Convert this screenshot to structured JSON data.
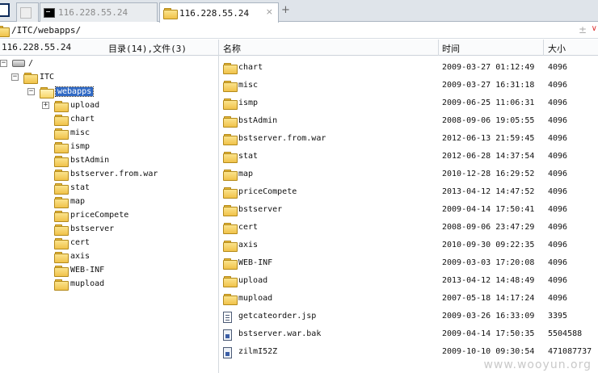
{
  "tabs": [
    {
      "label": "",
      "icon": "grey-square-icon"
    },
    {
      "label": "116.228.55.24",
      "icon": "terminal-icon"
    },
    {
      "label": "116.228.55.24",
      "icon": "folder-icon"
    }
  ],
  "tab_close": "×",
  "new_tab": "+",
  "address": {
    "path": "/ITC/webapps/",
    "add": "±",
    "menu": "∨"
  },
  "left_header": {
    "host": "116.228.55.24",
    "summary": "目录(14),文件(3)"
  },
  "tree": {
    "root": "/",
    "itc": "ITC",
    "webapps": "webapps",
    "children": [
      "upload",
      "chart",
      "misc",
      "ismp",
      "bstAdmin",
      "bstserver.from.war",
      "stat",
      "map",
      "priceCompete",
      "bstserver",
      "cert",
      "axis",
      "WEB-INF",
      "mupload"
    ]
  },
  "columns": {
    "name": "名称",
    "time": "时间",
    "size": "大小"
  },
  "files": [
    {
      "name": "chart",
      "time": "2009-03-27 01:12:49",
      "size": "4096",
      "type": "folder"
    },
    {
      "name": "misc",
      "time": "2009-03-27 16:31:18",
      "size": "4096",
      "type": "folder"
    },
    {
      "name": "ismp",
      "time": "2009-06-25 11:06:31",
      "size": "4096",
      "type": "folder"
    },
    {
      "name": "bstAdmin",
      "time": "2008-09-06 19:05:55",
      "size": "4096",
      "type": "folder"
    },
    {
      "name": "bstserver.from.war",
      "time": "2012-06-13 21:59:45",
      "size": "4096",
      "type": "folder"
    },
    {
      "name": "stat",
      "time": "2012-06-28 14:37:54",
      "size": "4096",
      "type": "folder"
    },
    {
      "name": "map",
      "time": "2010-12-28 16:29:52",
      "size": "4096",
      "type": "folder"
    },
    {
      "name": "priceCompete",
      "time": "2013-04-12 14:47:52",
      "size": "4096",
      "type": "folder"
    },
    {
      "name": "bstserver",
      "time": "2009-04-14 17:50:41",
      "size": "4096",
      "type": "folder"
    },
    {
      "name": "cert",
      "time": "2008-09-06 23:47:29",
      "size": "4096",
      "type": "folder"
    },
    {
      "name": "axis",
      "time": "2010-09-30 09:22:35",
      "size": "4096",
      "type": "folder"
    },
    {
      "name": "WEB-INF",
      "time": "2009-03-03 17:20:08",
      "size": "4096",
      "type": "folder"
    },
    {
      "name": "upload",
      "time": "2013-04-12 14:48:49",
      "size": "4096",
      "type": "folder"
    },
    {
      "name": "mupload",
      "time": "2007-05-18 14:17:24",
      "size": "4096",
      "type": "folder"
    },
    {
      "name": "getcateorder.jsp",
      "time": "2009-03-26 16:33:09",
      "size": "3395",
      "type": "file"
    },
    {
      "name": "bstserver.war.bak",
      "time": "2009-04-14 17:50:35",
      "size": "5504588",
      "type": "package"
    },
    {
      "name": "zilmI52Z",
      "time": "2009-10-10 09:30:54",
      "size": "471087737",
      "type": "package"
    }
  ],
  "watermark": "www.wooyun.org"
}
